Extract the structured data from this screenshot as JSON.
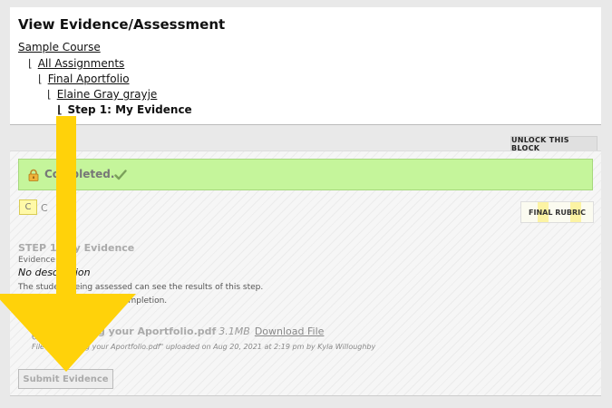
{
  "header": {
    "title": "View Evidence/Assessment"
  },
  "breadcrumbs": {
    "separator": "⌊",
    "items": [
      {
        "label": "Sample Course"
      },
      {
        "label": "All Assignments"
      },
      {
        "label": "Final Aportfolio"
      },
      {
        "label": "Elaine Gray grayje"
      },
      {
        "label": "Step 1: My Evidence"
      }
    ]
  },
  "toolbar": {
    "unlock_label": "UNLOCK THIS BLOCK"
  },
  "status": {
    "completed_text": "Completed.",
    "icon": "lock-icon",
    "check_icon": "check-icon",
    "bar_color": "#c5f59b"
  },
  "grade": {
    "letter": "C",
    "label": "C"
  },
  "rubric": {
    "label": "FINAL RUBRIC"
  },
  "step": {
    "heading": "STEP 1: My Evidence",
    "evidence_label": "Evidence",
    "description": "No description",
    "notice_results": "The student being assessed can see the results of this step.",
    "notice_lock": "This step is locked upon completion.",
    "evidence_subheading": "Evidence"
  },
  "file": {
    "name": "Submitting your Aportfolio.pdf",
    "size": "3.1MB",
    "download_label": "Download File",
    "upload_info": "File \"Submitting your Aportfolio.pdf\" uploaded on Aug 20, 2021 at 2:19 pm by Kyla Willoughby"
  },
  "actions": {
    "submit_label": "Submit Evidence"
  },
  "overlay": {
    "arrow_color": "#ffd20a"
  }
}
